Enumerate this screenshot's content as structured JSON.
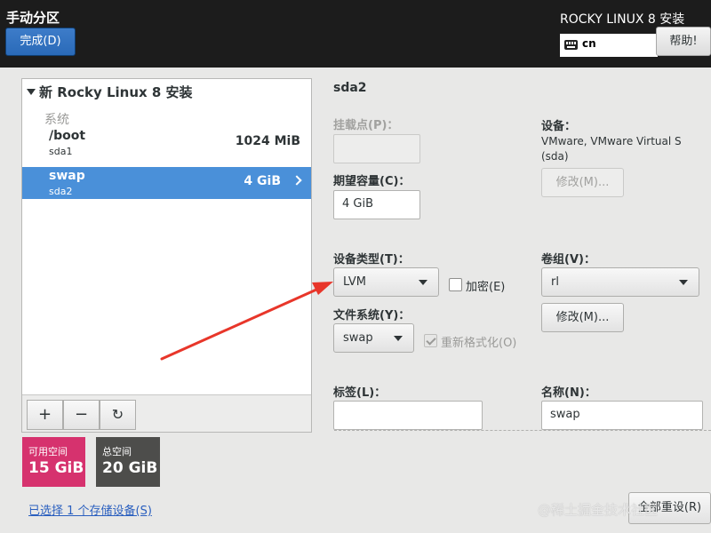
{
  "header": {
    "title": "手动分区",
    "done_label": "完成(D)",
    "product": "ROCKY LINUX 8 安装",
    "keyboard_layout": "cn",
    "help_label": "帮助!"
  },
  "tree": {
    "root_label": "新 Rocky Linux 8 安装",
    "group_label": "系统",
    "partitions": [
      {
        "name": "/boot",
        "device": "sda1",
        "size": "1024 MiB",
        "selected": false
      },
      {
        "name": "swap",
        "device": "sda2",
        "size": "4 GiB",
        "selected": true
      }
    ],
    "toolbar": {
      "add": "+",
      "remove": "−",
      "refresh": "↻"
    }
  },
  "space": {
    "available_label": "可用空间",
    "available_value": "15 GiB",
    "total_label": "总空间",
    "total_value": "20 GiB",
    "available_color": "#d6326e",
    "total_color": "#4d4d4b"
  },
  "storage_link": "已选择 1 个存储设备(S)",
  "detail": {
    "device_title": "sda2",
    "mount_point_label": "挂载点(P)：",
    "mount_point_value": "",
    "desired_capacity_label": "期望容量(C)：",
    "desired_capacity_value": "4 GiB",
    "device_label": "设备：",
    "device_desc": "VMware, VMware Virtual S",
    "device_desc2": "(sda)",
    "modify_disabled_label": "修改(M)...",
    "device_type_label": "设备类型(T)：",
    "device_type_value": "LVM",
    "encrypt_label": "加密(E)",
    "filesystem_label": "文件系统(Y)：",
    "filesystem_value": "swap",
    "reformat_label": "重新格式化(O)",
    "volume_group_label": "卷组(V)：",
    "volume_group_value": "rl",
    "modify_label": "修改(M)...",
    "label_label": "标签(L)：",
    "label_value": "",
    "name_label": "名称(N)：",
    "name_value": "swap"
  },
  "reset_label": "全部重设(R)",
  "watermark": "@稀土掘金技术社区",
  "annotation": {
    "arrow_color": "#e8362a"
  }
}
